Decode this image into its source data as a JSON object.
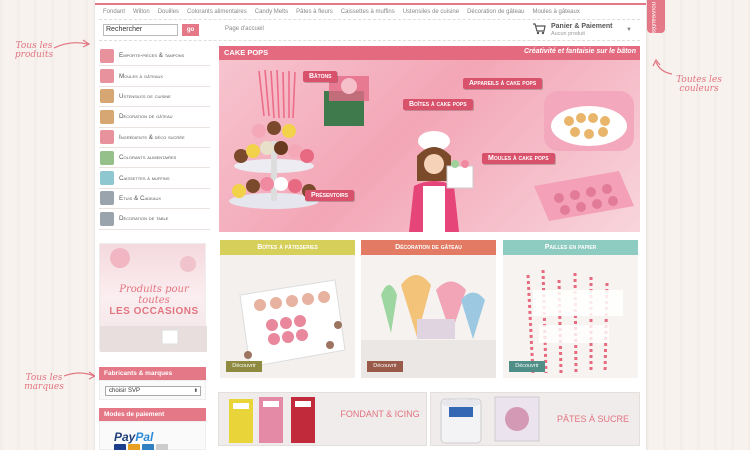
{
  "annotations": {
    "products": "Tous les produits",
    "colors": "Toutes les couleurs",
    "brands": "Tous les marques"
  },
  "side_tab": "nouveautés",
  "category_nav": [
    "Fondant",
    "Wilton",
    "Douilles",
    "Colorants alimentaires",
    "Candy Melts",
    "Pâtes à fleurs",
    "Caissettes à muffins",
    "Ustensiles de cuisine",
    "Décoration de gâteau",
    "Moules à gâteaux"
  ],
  "search": {
    "placeholder": "Rechercher",
    "button": "go"
  },
  "breadcrumb": "Page d'accueil",
  "cart": {
    "title": "Panier & Paiement",
    "subtitle": "Aucun produit"
  },
  "sidebar": {
    "items": [
      {
        "label": "Emporte-pièces & tampons",
        "icon": "cookie-cutter-icon"
      },
      {
        "label": "Moules à gâteaux",
        "icon": "cake-mold-icon"
      },
      {
        "label": "Ustensiles de cuisine",
        "icon": "utensils-icon"
      },
      {
        "label": "Décoration de gâteau",
        "icon": "cake-decoration-icon"
      },
      {
        "label": "Ingrédients & déco sucrée",
        "icon": "ingredients-icon"
      },
      {
        "label": "Colorants alimentaires",
        "icon": "food-coloring-icon"
      },
      {
        "label": "Caissettes à muffins",
        "icon": "muffin-cup-icon"
      },
      {
        "label": "Etuis & Cadeaux",
        "icon": "gift-box-icon"
      },
      {
        "label": "Décoration de table",
        "icon": "table-decoration-icon"
      }
    ]
  },
  "side_banner": {
    "script": "Produits pour toutes",
    "caps": "LES OCCASIONS"
  },
  "brands_box": {
    "title": "Fabricants & marques",
    "select_value": "choisir SVP"
  },
  "payment_box": {
    "title": "Modes de paiement",
    "paypal_a": "Pay",
    "paypal_b": "Pal"
  },
  "hero": {
    "title": "CAKE POPS",
    "tagline": "Créativité et fantaisie sur le bâton",
    "labels": {
      "batons": "Bâtons",
      "boites": "Boîtes à cake pops",
      "appareils": "Appareils à cake pops",
      "moules": "Moules à cake pops",
      "presentoirs": "Présentoirs"
    }
  },
  "tiles": [
    {
      "title": "Boîtes à pâtisseries",
      "button": "Découvrir",
      "color": "#d6cf59"
    },
    {
      "title": "Décoration de gâteau",
      "button": "Découvrir",
      "color": "#e27a64"
    },
    {
      "title": "Pailles en papier",
      "button": "Découvrir",
      "color": "#8ecbc1"
    }
  ],
  "promos": [
    {
      "title": "FONDANT & ICING"
    },
    {
      "title": "PÂTES À SUCRE"
    }
  ],
  "colors": {
    "accent": "#e57886",
    "hero_bar": "#e36a7f",
    "label": "#d9526b"
  }
}
